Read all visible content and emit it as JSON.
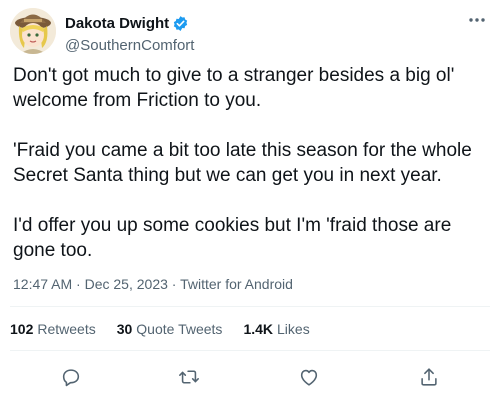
{
  "user": {
    "display_name": "Dakota Dwight",
    "handle": "@SouthernComfort",
    "verified_icon": "verified-badge-icon",
    "verified_color": "#1d9bf0"
  },
  "tweet": {
    "paragraphs": [
      "Don't got much to give to a stranger besides a big ol' welcome from Friction to you.",
      "'Fraid you came a bit too late this season for the whole Secret Santa thing but we can get you in next year.",
      "I'd offer you up some cookies but I'm 'fraid those are gone too."
    ],
    "time": "12:47 AM",
    "date": "Dec 25, 2023",
    "source": "Twitter for Android",
    "separator": "·"
  },
  "stats": {
    "retweets": {
      "count": "102",
      "label": "Retweets"
    },
    "quotes": {
      "count": "30",
      "label": "Quote Tweets"
    },
    "likes": {
      "count": "1.4K",
      "label": "Likes"
    }
  },
  "actions": [
    "reply-icon",
    "retweet-icon",
    "like-icon",
    "share-icon"
  ],
  "colors": {
    "text": "#0f1419",
    "secondary": "#536471",
    "divider": "#eff3f4"
  }
}
